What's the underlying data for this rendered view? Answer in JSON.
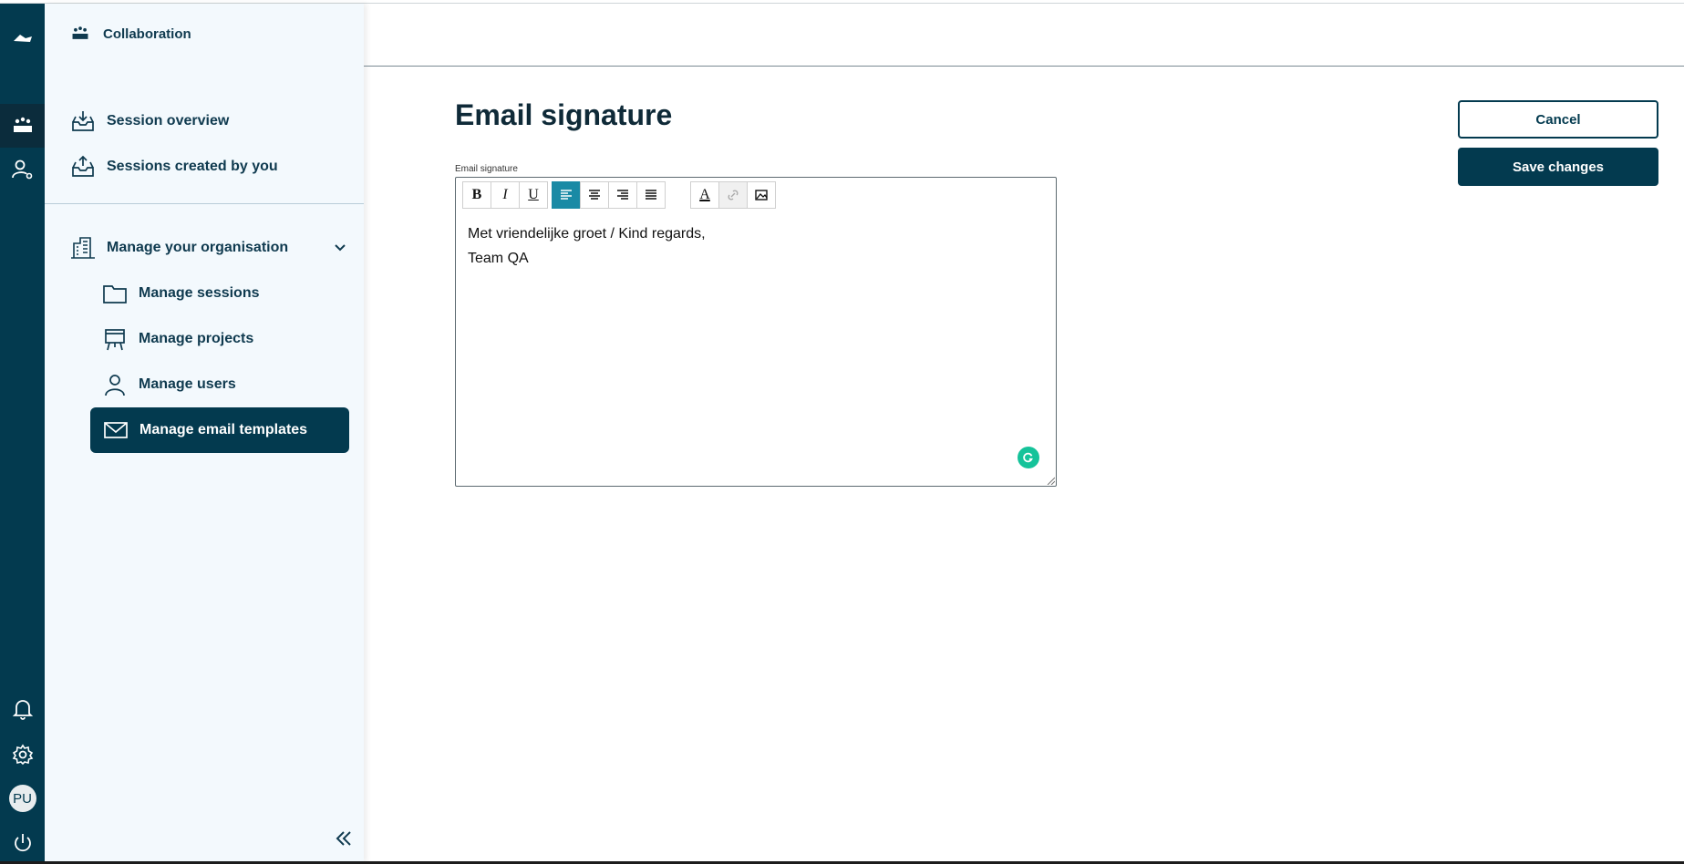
{
  "sidebar": {
    "app_title": "Collaboration",
    "items": [
      {
        "label": "Session overview"
      },
      {
        "label": "Sessions created by you"
      },
      {
        "label": "Manage your organisation"
      },
      {
        "label": "Manage sessions"
      },
      {
        "label": "Manage projects"
      },
      {
        "label": "Manage users"
      },
      {
        "label": "Manage email templates"
      }
    ]
  },
  "rail": {
    "avatar_initials": "PU"
  },
  "main": {
    "title": "Email signature",
    "field_label": "Email signature",
    "editor": {
      "lines": [
        "Met vriendelijke groet / Kind regards,",
        "Team QA"
      ],
      "toolbar": {
        "bold": "B",
        "italic": "I",
        "underline": "U",
        "font_color": "A"
      }
    },
    "cancel_label": "Cancel",
    "save_label": "Save changes"
  },
  "colors": {
    "primary": "#033a4f",
    "sidebar_bg": "#f3f9fd",
    "toolbar_active": "#1a8aa5",
    "grammarly": "#15c39a"
  }
}
